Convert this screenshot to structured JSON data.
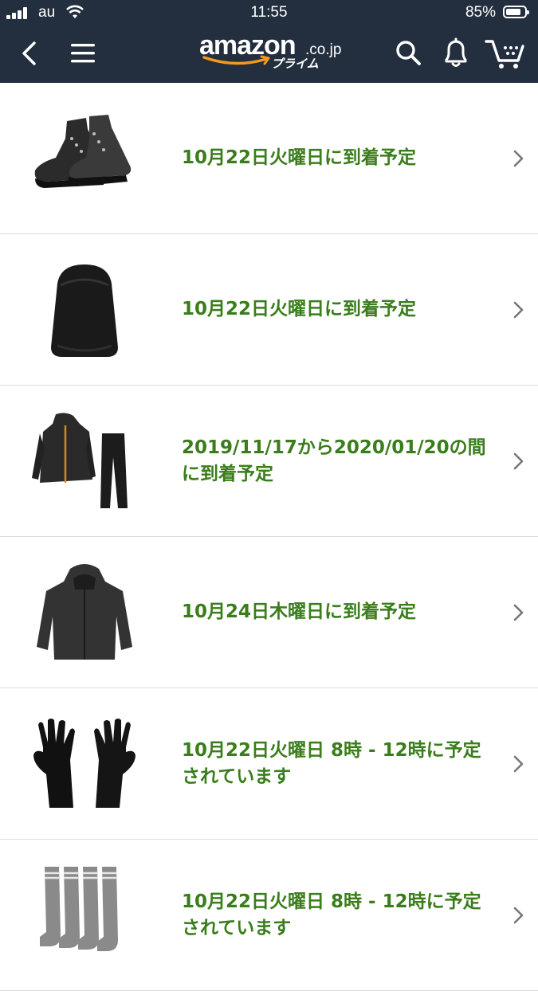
{
  "status_bar": {
    "carrier": "au",
    "time": "11:55",
    "battery": "85%",
    "battery_level": 0.85
  },
  "header": {
    "logo_word": "amazon",
    "logo_tld": ".co.jp",
    "logo_sub": "プライム",
    "icons": [
      "back-icon",
      "menu-icon",
      "search-icon",
      "bell-icon",
      "cart-icon"
    ]
  },
  "colors": {
    "header_bg": "#232f3e",
    "delivery_text": "#3a7d1b",
    "logo_smile": "#f29a1f"
  },
  "orders": [
    {
      "product": "boots",
      "delivery": "10月22日火曜日に到着予定"
    },
    {
      "product": "backpack-cover",
      "delivery": "10月22日火曜日に到着予定"
    },
    {
      "product": "rain-suit",
      "delivery": "2019/11/17から2020/01/20の間に到着予定"
    },
    {
      "product": "jacket",
      "delivery": "10月24日木曜日に到着予定"
    },
    {
      "product": "gloves",
      "delivery": "10月22日火曜日 8時 - 12時に予定されています"
    },
    {
      "product": "socks",
      "delivery": "10月22日火曜日 8時 - 12時に予定されています"
    }
  ]
}
